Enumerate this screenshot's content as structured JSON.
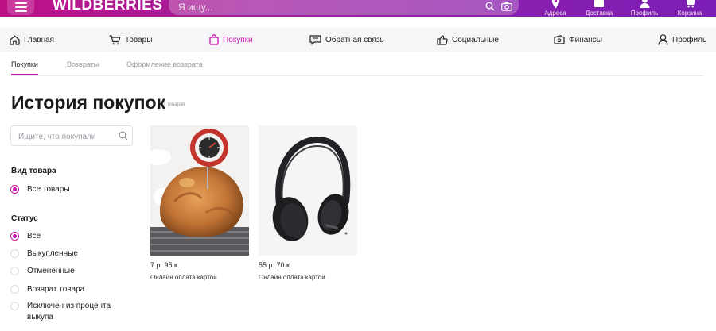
{
  "header": {
    "logo": "WILDBERRIES",
    "search_placeholder": "Я ищу...",
    "nav": [
      {
        "label": "Адреса",
        "icon": "location-pin-icon"
      },
      {
        "label": "Доставка",
        "icon": "delivery-icon"
      },
      {
        "label": "Профиль",
        "icon": "profile-icon"
      },
      {
        "label": "Корзина",
        "icon": "cart-icon"
      }
    ]
  },
  "main_nav": [
    {
      "label": "Главная",
      "icon": "home-icon"
    },
    {
      "label": "Товары",
      "icon": "cart-icon"
    },
    {
      "label": "Покупки",
      "icon": "shopping-bag-icon",
      "active": true
    },
    {
      "label": "Обратная связь",
      "icon": "chat-icon"
    },
    {
      "label": "Социальные",
      "icon": "thumbs-up-icon"
    },
    {
      "label": "Финансы",
      "icon": "wallet-icon"
    },
    {
      "label": "Профиль",
      "icon": "user-icon"
    }
  ],
  "sub_tabs": [
    {
      "label": "Покупки",
      "active": true
    },
    {
      "label": "Возвраты"
    },
    {
      "label": "Оформление возврата"
    }
  ],
  "page": {
    "title": "История покупок",
    "count": "3 товаров"
  },
  "filters": {
    "search_placeholder": "Ищите, что покупали",
    "type_title": "Вид товара",
    "type_options": [
      {
        "label": "Все товары",
        "checked": true
      }
    ],
    "status_title": "Статус",
    "status_options": [
      {
        "label": "Все",
        "checked": true
      },
      {
        "label": "Выкупленные"
      },
      {
        "label": "Отмененные"
      },
      {
        "label": "Возврат товара"
      },
      {
        "label": "Исключен из процента выкупа"
      }
    ]
  },
  "products": [
    {
      "price": "7 р. 95 к.",
      "payment": "Онлайн оплата картой",
      "image": "roast-chicken-thermometer"
    },
    {
      "price": "55 р. 70 к.",
      "payment": "Онлайн оплата картой",
      "image": "headphones"
    }
  ],
  "colors": {
    "brand": "#cb11ab",
    "header_gradient_start": "#bf1187",
    "header_gradient_end": "#7b1eb6"
  }
}
